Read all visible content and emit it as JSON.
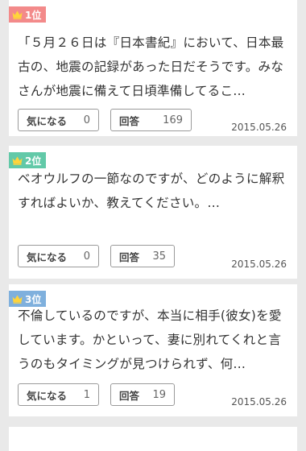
{
  "colors": {
    "rank1": "#f38a8a",
    "rank2": "#62c9a8",
    "rank3": "#7fb0dd",
    "crown": "#ffd43b",
    "background": "#e9e9e9"
  },
  "labels": {
    "mark": "気になる",
    "answer": "回答"
  },
  "questions": [
    {
      "rank": "1位",
      "text": "「５月２６日は『日本書紀』において、日本最古の、地震の記録があった日だそうです。みなさんが地震に備えて日頃準備してるこ…",
      "mark_count": "0",
      "answer_count": "169",
      "date": "2015.05.26"
    },
    {
      "rank": "2位",
      "text": "ベオウルフの一節なのですが、どのように解釈すればよいか、教えてください。…",
      "mark_count": "0",
      "answer_count": "35",
      "date": "2015.05.26"
    },
    {
      "rank": "3位",
      "text": "不倫しているのですが、本当に相手(彼女)を愛しています。かといって、妻に別れてくれと言うのもタイミングが見つけられず、何…",
      "mark_count": "1",
      "answer_count": "19",
      "date": "2015.05.26"
    }
  ]
}
